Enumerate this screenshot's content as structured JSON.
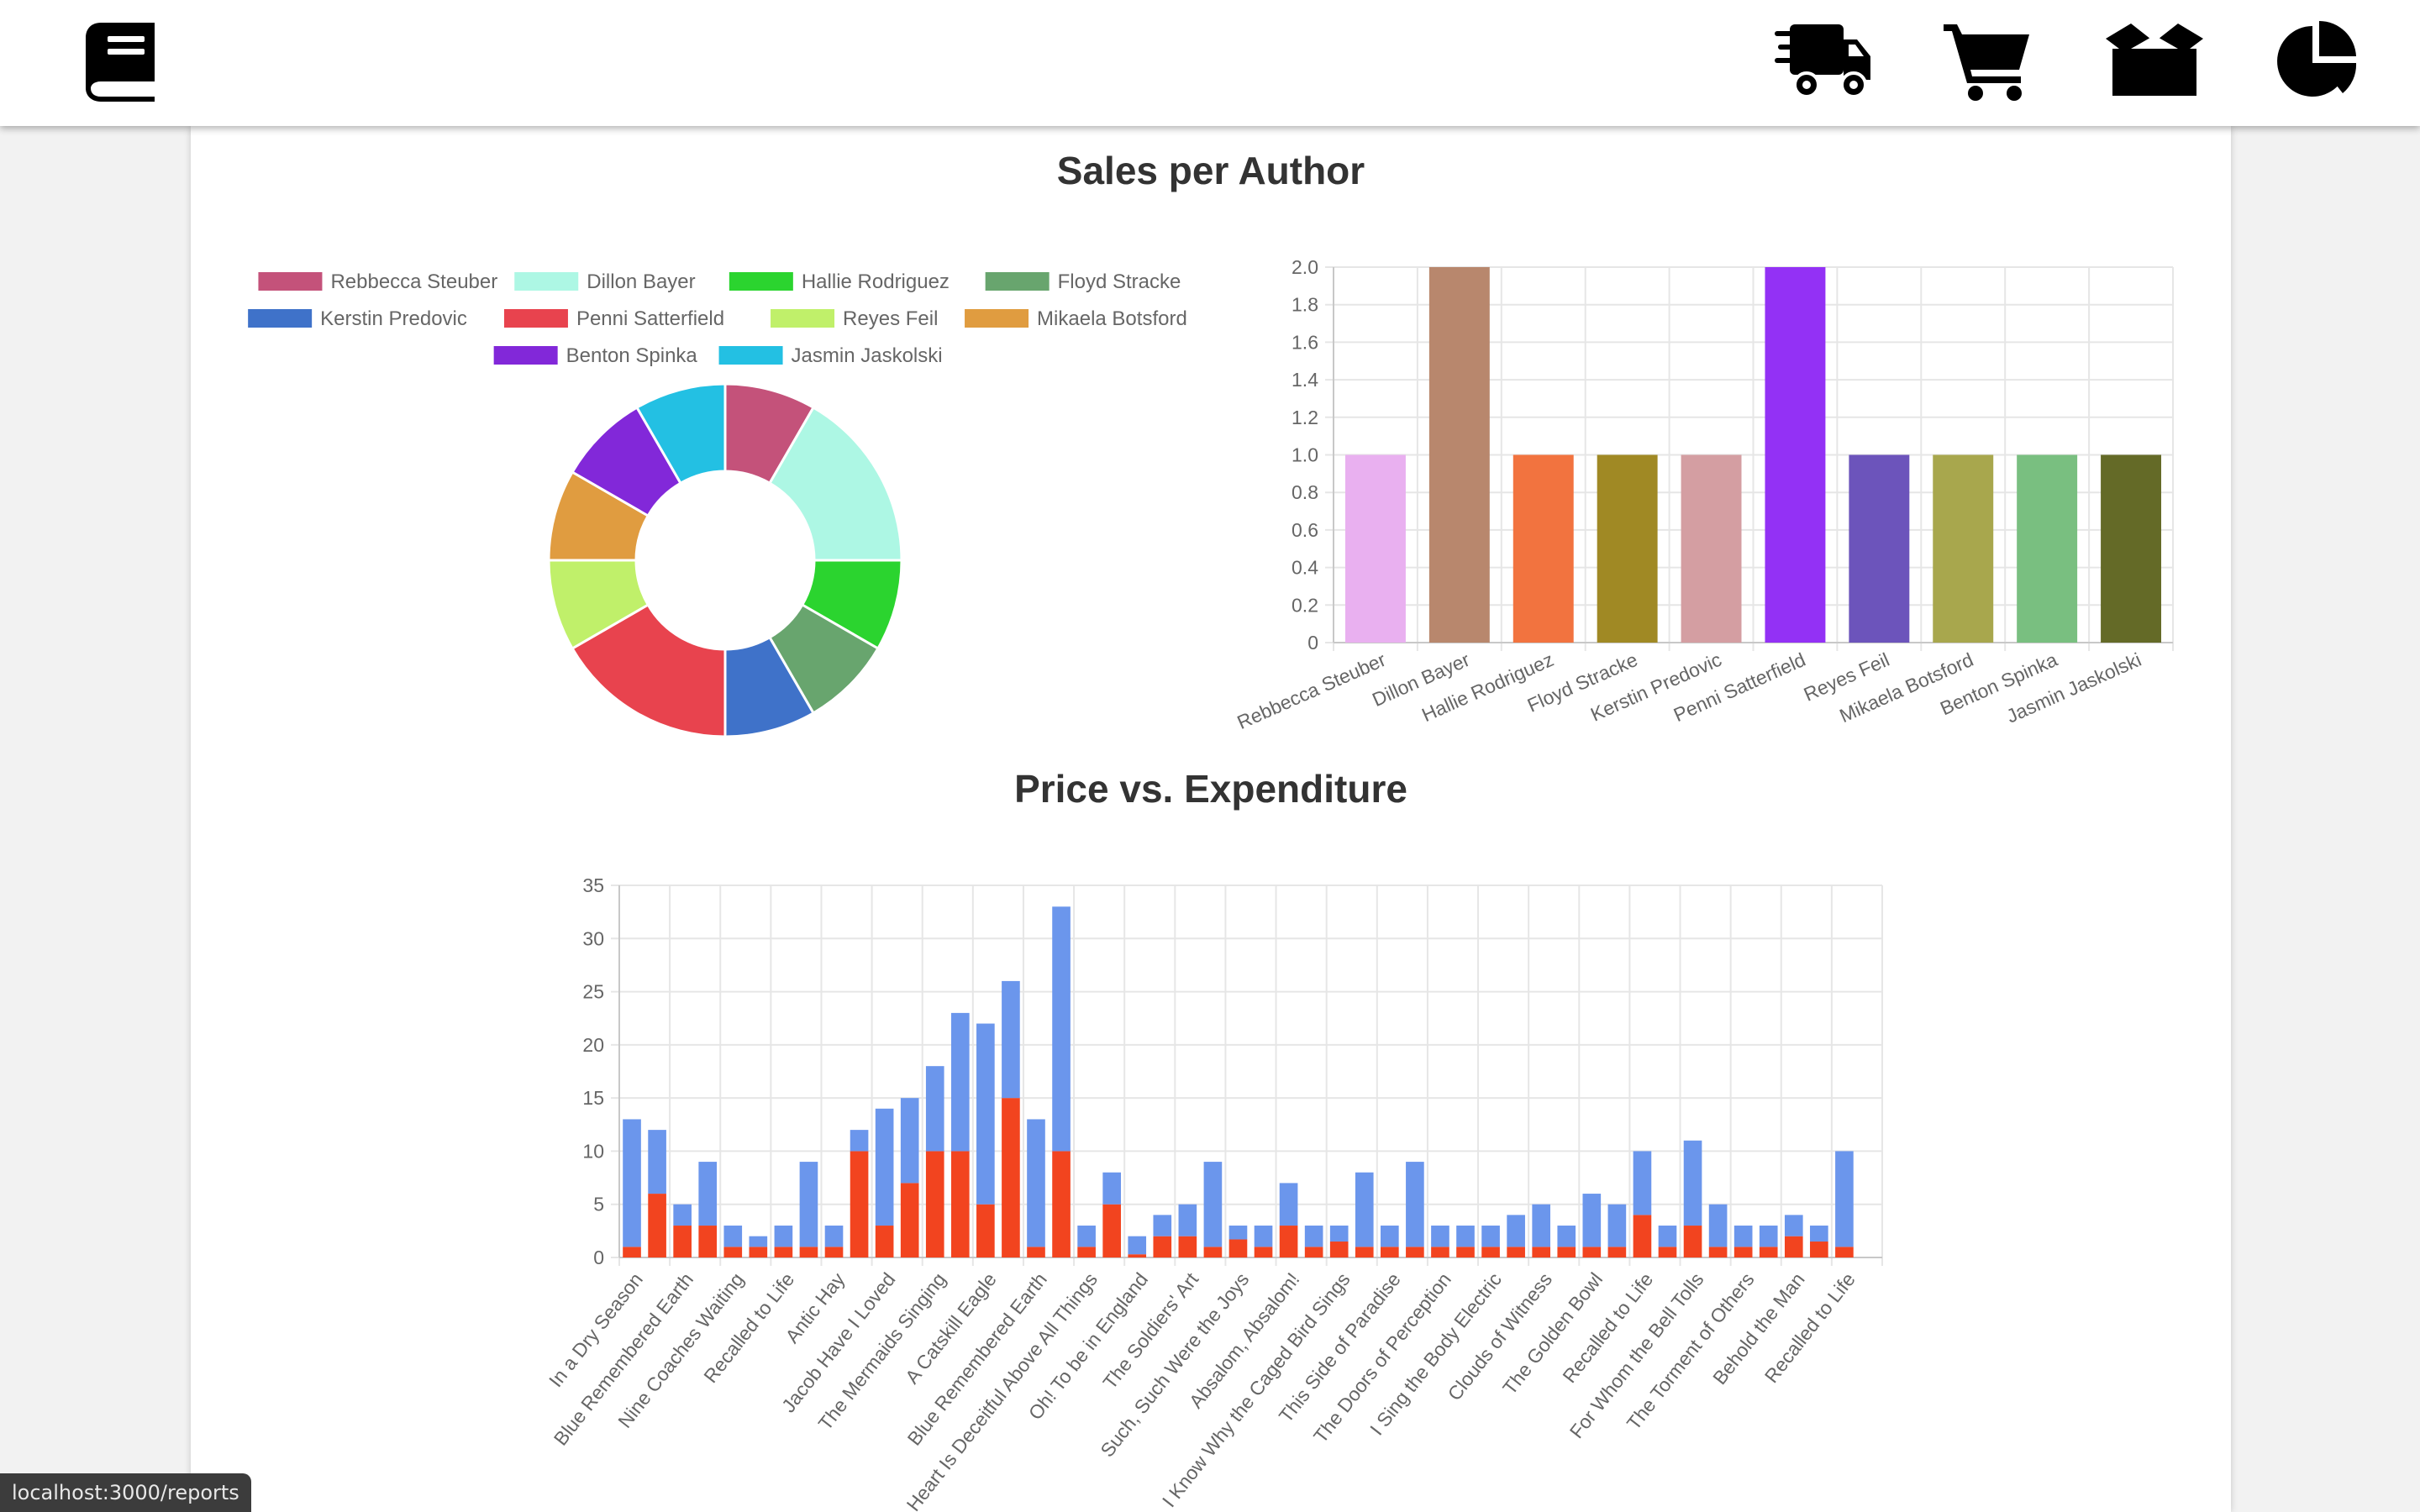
{
  "nav": {
    "icons": [
      "book-icon",
      "shipping-truck-icon",
      "shopping-cart-icon",
      "open-box-icon",
      "pie-chart-icon"
    ]
  },
  "colors": {
    "accent_text": "#333333",
    "grid": "#e6e6e6",
    "axis_text": "#666666"
  },
  "reports": {
    "sales_title": "Sales per Author",
    "price_title": "Price vs. Expenditure"
  },
  "chart_data": [
    {
      "type": "pie",
      "variant": "doughnut",
      "legend_position": "top",
      "categories": [
        "Rebbecca Steuber",
        "Dillon Bayer",
        "Hallie Rodriguez",
        "Floyd Stracke",
        "Kerstin Predovic",
        "Penni Satterfield",
        "Reyes Feil",
        "Mikaela Botsford",
        "Benton Spinka",
        "Jasmin Jaskolski"
      ],
      "values": [
        1,
        2,
        1,
        1,
        1,
        2,
        1,
        1,
        1,
        1
      ],
      "colors": [
        "#c4527a",
        "#adf7e4",
        "#2bd42f",
        "#68a56e",
        "#3f72c9",
        "#e8434e",
        "#c0f06a",
        "#e09c40",
        "#8228d9",
        "#23c0e3"
      ]
    },
    {
      "type": "bar",
      "categories": [
        "Rebbecca Steuber",
        "Dillon Bayer",
        "Hallie Rodriguez",
        "Floyd Stracke",
        "Kerstin Predovic",
        "Penni Satterfield",
        "Reyes Feil",
        "Mikaela Botsford",
        "Benton Spinka",
        "Jasmin Jaskolski"
      ],
      "values": [
        1,
        2,
        1,
        1,
        1,
        2,
        1,
        1,
        1,
        1
      ],
      "colors": [
        "#e9b0f0",
        "#b8876d",
        "#f2733f",
        "#a08924",
        "#d49ea2",
        "#9331f5",
        "#6c54bb",
        "#a8a74d",
        "#79bf80",
        "#646a27"
      ],
      "ylim": [
        0,
        2.0
      ],
      "y_ticks": [
        "0",
        "0.2",
        "0.4",
        "0.6",
        "0.8",
        "1.0",
        "1.2",
        "1.4",
        "1.6",
        "1.8",
        "2.0"
      ],
      "grid": true,
      "legend": false
    },
    {
      "type": "bar",
      "stacked": true,
      "categories": [
        "In a Dry Season",
        "",
        "Blue Remembered Earth",
        "",
        "Nine Coaches Waiting",
        "",
        "Recalled to Life",
        "",
        "Antic Hay",
        "",
        "Jacob Have I Loved",
        "",
        "The Mermaids Singing",
        "",
        "A Catskill Eagle",
        "",
        "Blue Remembered Earth",
        "",
        "The Heart Is Deceitful Above All Things",
        "",
        "Oh! To be in England",
        "",
        "The Soldiers' Art",
        "",
        "Such, Such Were the Joys",
        "",
        "Absalom, Absalom!",
        "",
        "I Know Why the Caged Bird Sings",
        "",
        "This Side of Paradise",
        "",
        "The Doors of Perception",
        "",
        "I Sing the Body Electric",
        "",
        "Clouds of Witness",
        "",
        "The Golden Bowl",
        "",
        "Recalled to Life",
        "",
        "For Whom the Bell Tolls",
        "",
        "The Torment of Others",
        "",
        "Behold the Man",
        "",
        "Recalled to Life",
        ""
      ],
      "series": [
        {
          "color": "#f2441f",
          "values": [
            1,
            6,
            3,
            3,
            1,
            1,
            1,
            1,
            1,
            10,
            3,
            7,
            10,
            10,
            5,
            15,
            1,
            10,
            1,
            5,
            0.3,
            2,
            2,
            1,
            1.7,
            1,
            3,
            1,
            1.5,
            1,
            1,
            1,
            1,
            1,
            1,
            1,
            1,
            1,
            1,
            1,
            4,
            1,
            3,
            1,
            1,
            1,
            2,
            1.5,
            1
          ]
        },
        {
          "color": "#6b96ec",
          "values": [
            12,
            6,
            2,
            6,
            2,
            1,
            2,
            8,
            2,
            2,
            11,
            8,
            8,
            13,
            17,
            11,
            12,
            23,
            2,
            3,
            1.7,
            2,
            3,
            8,
            1.3,
            2,
            4,
            2,
            1.5,
            7,
            2,
            8,
            2,
            2,
            2,
            3,
            4,
            2,
            5,
            4,
            6,
            2,
            8,
            4,
            2,
            2,
            2,
            1.5,
            9
          ]
        }
      ],
      "ylim": [
        0,
        35
      ],
      "y_ticks": [
        "0",
        "5",
        "10",
        "15",
        "20",
        "25",
        "30",
        "35"
      ],
      "grid": true,
      "legend": false
    }
  ],
  "status_bar": {
    "url": "localhost:3000/reports"
  }
}
